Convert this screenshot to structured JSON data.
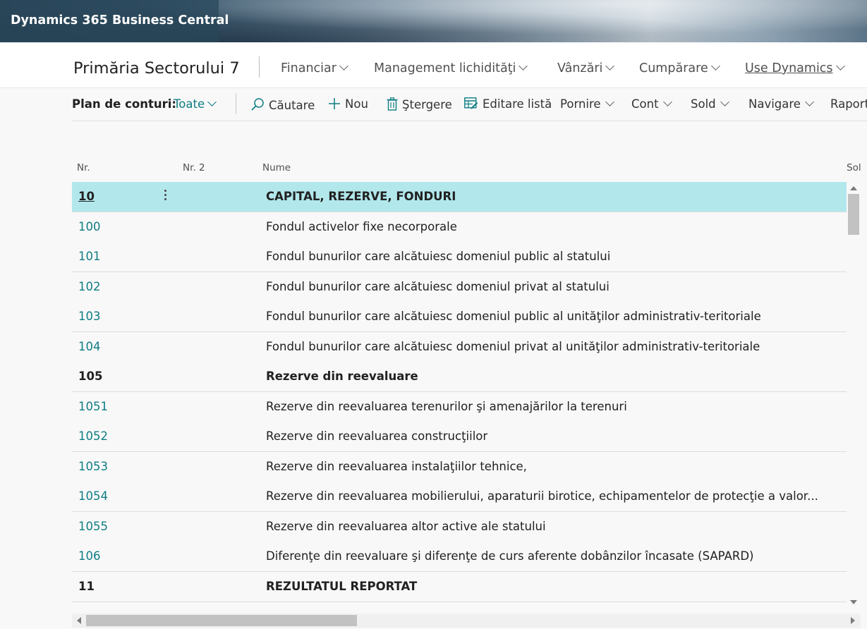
{
  "app": {
    "title": "Dynamics 365 Business Central"
  },
  "nav": {
    "company": "Primăria Sectorului 7",
    "items": [
      {
        "label": "Financiar"
      },
      {
        "label": "Management lichidităţi"
      },
      {
        "label": "Vânzări"
      },
      {
        "label": "Cumpărare"
      },
      {
        "label": "Use Dynamics"
      }
    ]
  },
  "actionbar": {
    "page_label": "Plan de conturi:",
    "filter_label": "Toate",
    "search_label": "Căutare",
    "new_label": "Nou",
    "delete_label": "Ştergere",
    "edit_list_label": "Editare listă",
    "start_label": "Pornire",
    "account_label": "Cont",
    "balance_label": "Sold",
    "navigate_label": "Navigare",
    "report_label": "Raport"
  },
  "table": {
    "columns": {
      "nr": "Nr.",
      "nr2": "Nr. 2",
      "nume": "Nume",
      "sold": "Sol"
    },
    "rows": [
      {
        "nr": "10",
        "nume": "CAPITAL, REZERVE, FONDURI",
        "heading": true,
        "selected": true
      },
      {
        "nr": "100",
        "nume": "Fondul activelor fixe necorporale"
      },
      {
        "nr": "101",
        "nume": "Fondul bunurilor care alcătuiesc domeniul public al statului"
      },
      {
        "nr": "102",
        "nume": "Fondul bunurilor care alcătuiesc domeniul privat al statului"
      },
      {
        "nr": "103",
        "nume": "Fondul bunurilor care alcătuiesc domeniul public al unităţilor administrativ-teritoriale"
      },
      {
        "nr": "104",
        "nume": "Fondul bunurilor care alcătuiesc domeniul privat al unităţilor administrativ-teritoriale"
      },
      {
        "nr": "105",
        "nume": "Rezerve din reevaluare",
        "heading": true
      },
      {
        "nr": "1051",
        "nume": "Rezerve din reevaluarea terenurilor şi amenajărilor la terenuri"
      },
      {
        "nr": "1052",
        "nume": "Rezerve din reevaluarea construcţiilor"
      },
      {
        "nr": "1053",
        "nume": "Rezerve din reevaluarea instalaţiilor tehnice,"
      },
      {
        "nr": "1054",
        "nume": "Rezerve din reevaluarea mobilierului, aparaturii birotice, echipamentelor de protecţie a valor..."
      },
      {
        "nr": "1055",
        "nume": "Rezerve din reevaluarea altor active ale statului"
      },
      {
        "nr": "106",
        "nume": "Diferenţe din reevaluare şi diferenţe de curs aferente dobânzilor încasate (SAPARD)"
      },
      {
        "nr": "11",
        "nume": "REZULTATUL REPORTAT",
        "heading": true
      }
    ]
  },
  "colors": {
    "accent": "#0f7d83",
    "selected_row": "#b2e8ec"
  },
  "icons": [
    "search-icon",
    "add-icon",
    "delete-icon",
    "edit-list-icon",
    "chevron-down-icon",
    "row-actions-icon"
  ]
}
